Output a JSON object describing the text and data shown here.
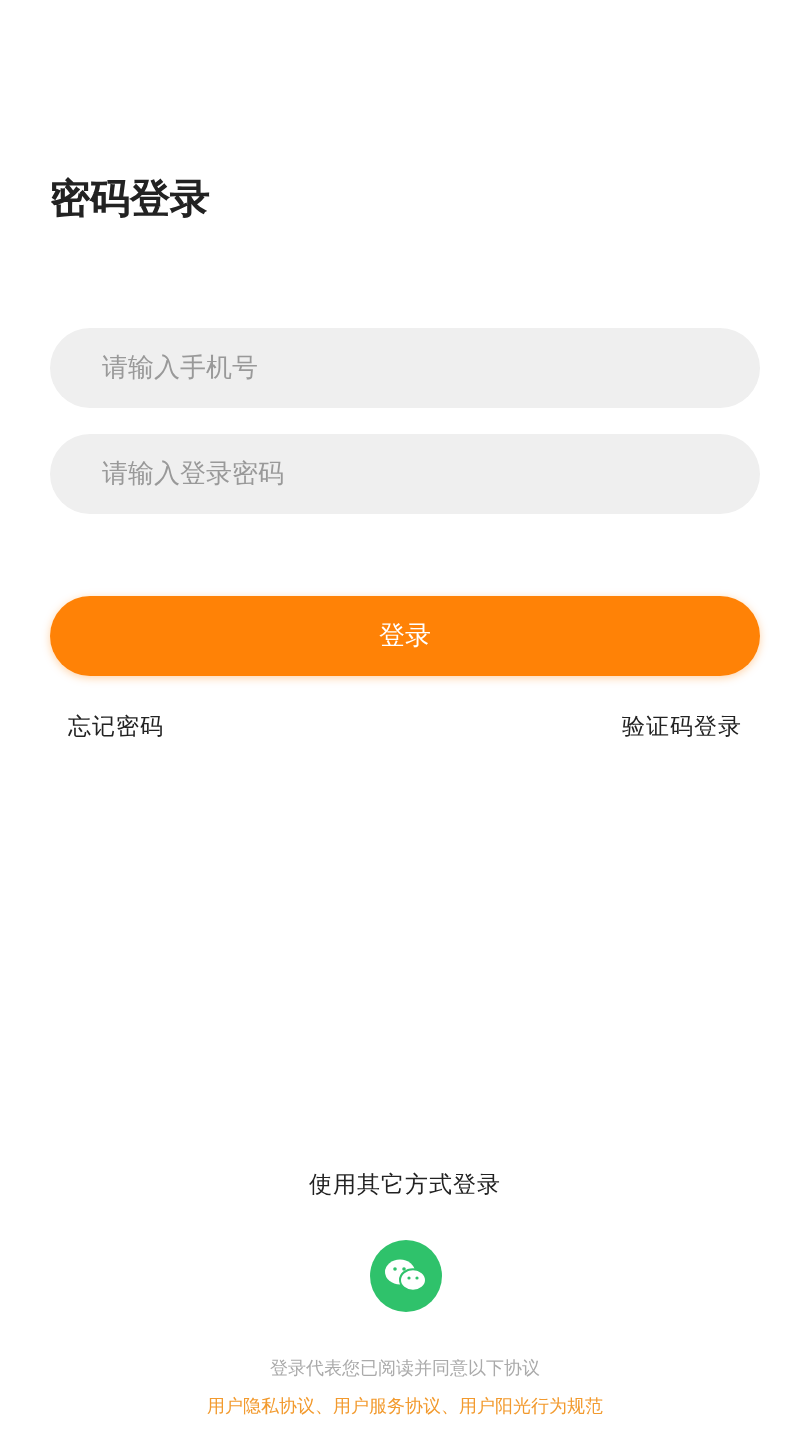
{
  "title": "密码登录",
  "fields": [
    {
      "placeholder": "请输入手机号"
    },
    {
      "placeholder": "请输入登录密码"
    }
  ],
  "login_button": "登录",
  "forgot_link": "忘记密码",
  "sms_login_link": "验证码登录",
  "other_methods": {
    "label": "使用其它方式登录"
  },
  "agreement": {
    "text": "登录代表您已阅读并同意以下协议",
    "separator": "、",
    "links": [
      "用户隐私协议",
      "用户服务协议",
      "用户阳光行为规范"
    ]
  }
}
